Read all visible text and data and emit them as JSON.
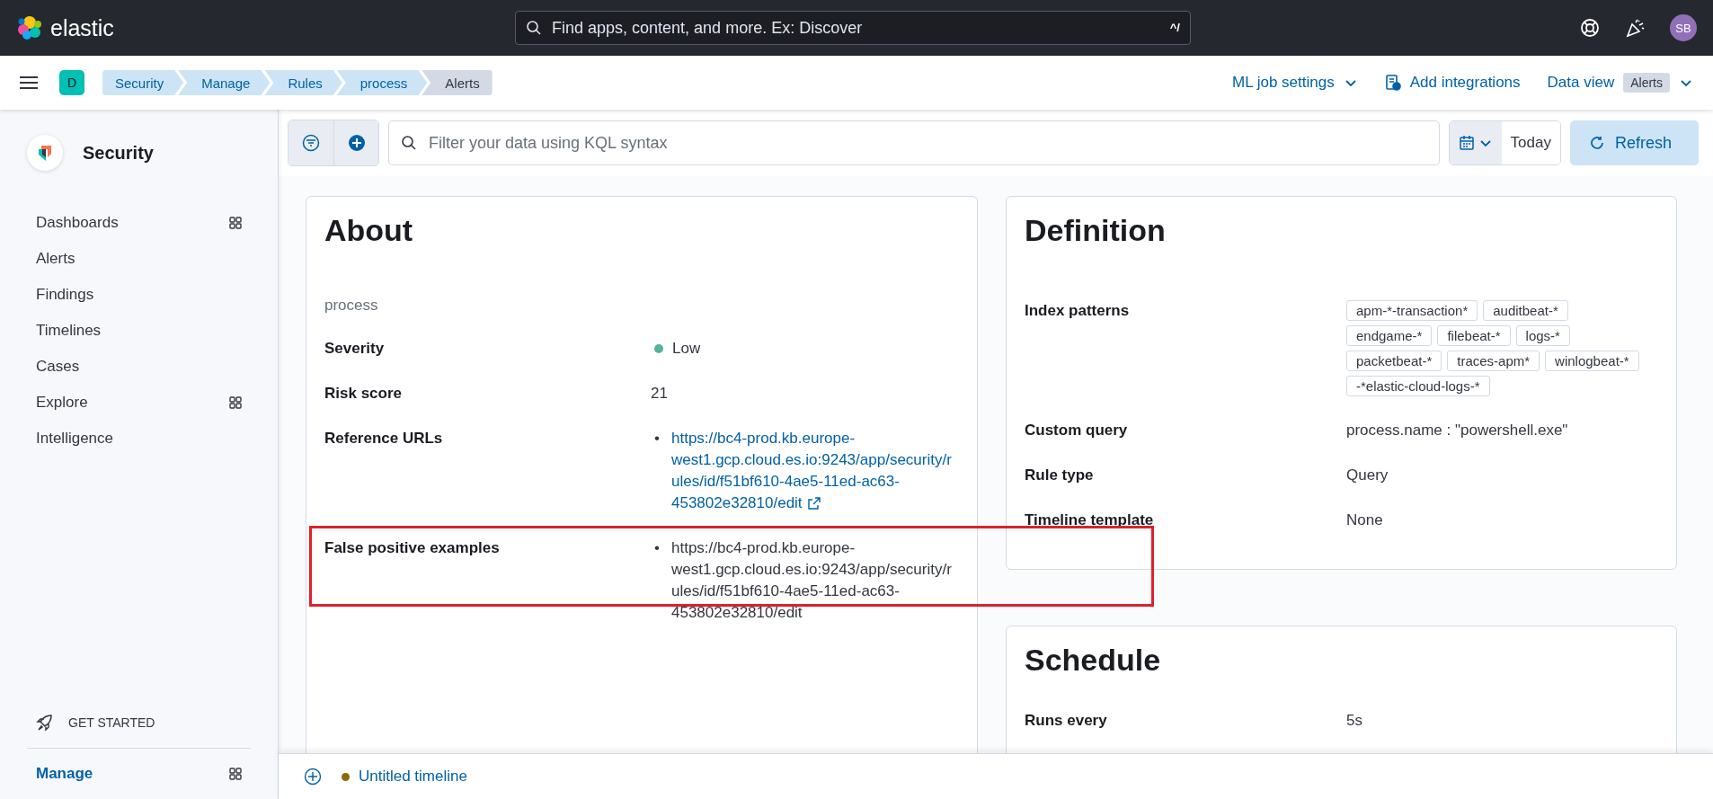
{
  "header": {
    "logo_text": "elastic",
    "search": {
      "placeholder": "Find apps, content, and more. Ex: Discover",
      "shortcut": "^/"
    },
    "avatar": "SB"
  },
  "navbar": {
    "space": "D",
    "breadcrumbs": [
      {
        "label": "Security",
        "selected": false
      },
      {
        "label": "Manage",
        "selected": false
      },
      {
        "label": "Rules",
        "selected": false
      },
      {
        "label": "process",
        "selected": false
      },
      {
        "label": "Alerts",
        "selected": true
      }
    ],
    "ml_job_settings": "ML job settings",
    "add_integrations": "Add integrations",
    "data_view": {
      "label": "Data view",
      "value": "Alerts"
    }
  },
  "sidebar": {
    "title": "Security",
    "items": [
      {
        "label": "Dashboards",
        "panel": true,
        "selected": false
      },
      {
        "label": "Alerts",
        "panel": false,
        "selected": false
      },
      {
        "label": "Findings",
        "panel": false,
        "selected": false
      },
      {
        "label": "Timelines",
        "panel": false,
        "selected": false
      },
      {
        "label": "Cases",
        "panel": false,
        "selected": false
      },
      {
        "label": "Explore",
        "panel": true,
        "selected": false
      },
      {
        "label": "Intelligence",
        "panel": false,
        "selected": false
      }
    ],
    "get_started": "GET STARTED",
    "manage": {
      "label": "Manage",
      "panel": true,
      "selected": true
    }
  },
  "query_bar": {
    "placeholder": "Filter your data using KQL syntax",
    "date": "Today",
    "refresh": "Refresh"
  },
  "about": {
    "title": "About",
    "description": "process",
    "fields": [
      {
        "label": "Severity",
        "kind": "severity",
        "value": "Low",
        "color": "#54b399"
      },
      {
        "label": "Risk score",
        "kind": "text",
        "value": "21"
      },
      {
        "label": "Reference URLs",
        "kind": "links",
        "marker": "•",
        "values": [
          "https://bc4-prod.kb.europe-west1.gcp.cloud.es.io:9243/app/security/rules/id/f51bf610-4ae5-11ed-ac63-453802e32810/edit"
        ],
        "highlighted": false
      },
      {
        "label": "False positive examples",
        "kind": "list",
        "marker": "•",
        "values": [
          "https://bc4-prod.kb.europe-west1.gcp.cloud.es.io:9243/app/security/rules/id/f51bf610-4ae5-11ed-ac63-453802e32810/edit"
        ],
        "highlighted": true
      }
    ]
  },
  "definition": {
    "title": "Definition",
    "fields": [
      {
        "label": "Index patterns",
        "kind": "tags",
        "values": [
          "apm-*-transaction*",
          "auditbeat-*",
          "endgame-*",
          "filebeat-*",
          "logs-*",
          "packetbeat-*",
          "traces-apm*",
          "winlogbeat-*",
          "-*elastic-cloud-logs-*"
        ]
      },
      {
        "label": "Custom query",
        "kind": "text",
        "value": "process.name : \"powershell.exe\""
      },
      {
        "label": "Rule type",
        "kind": "text",
        "value": "Query"
      },
      {
        "label": "Timeline template",
        "kind": "text",
        "value": "None"
      }
    ]
  },
  "schedule": {
    "title": "Schedule",
    "fields": [
      {
        "label": "Runs every",
        "kind": "text",
        "value": "5s"
      }
    ]
  },
  "timeline": {
    "title": "Untitled timeline"
  }
}
